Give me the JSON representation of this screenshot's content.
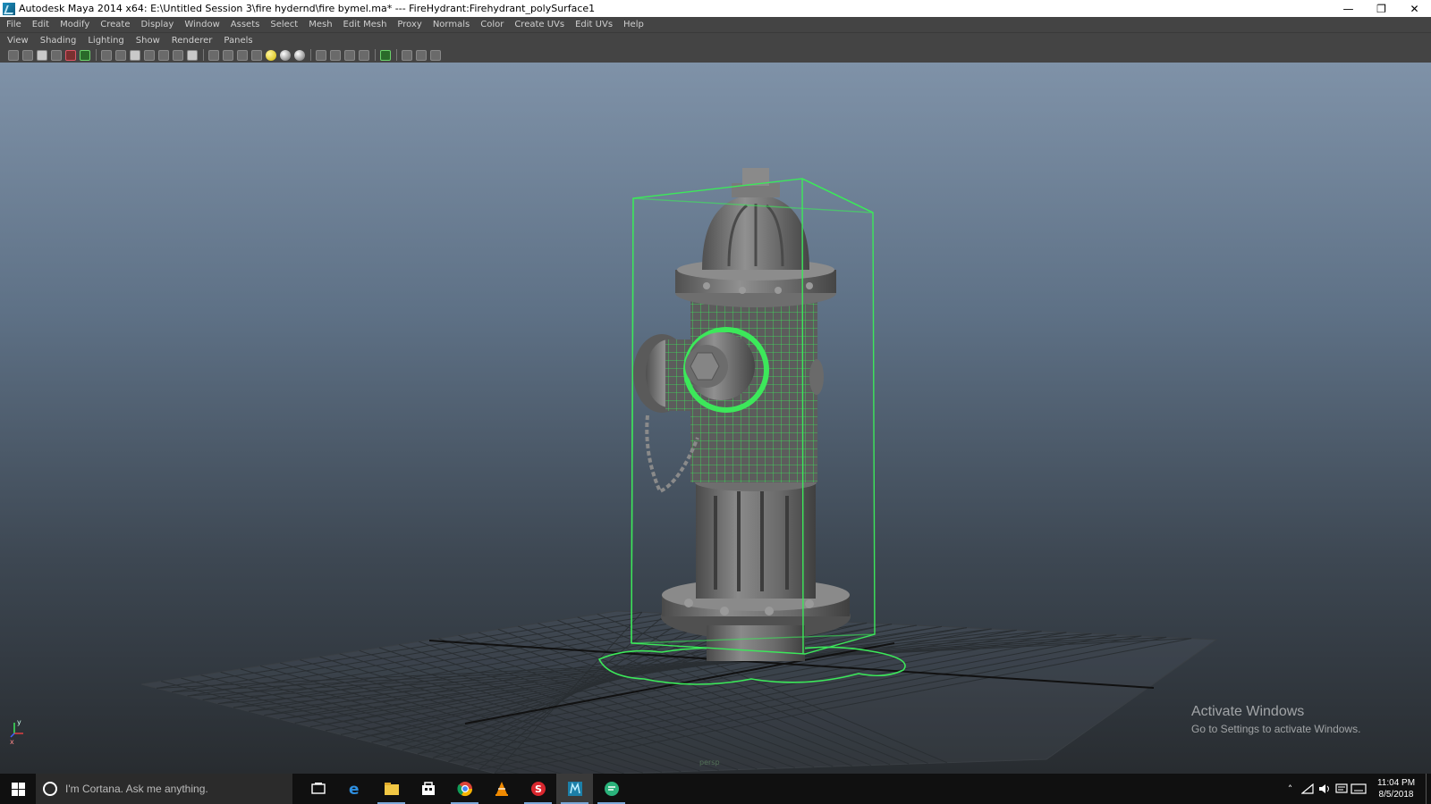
{
  "window": {
    "title": "Autodesk Maya 2014 x64: E:\\Untitled Session 3\\fire hydernd\\fire bymel.ma*   ---   FireHydrant:Firehydrant_polySurface1",
    "minimize_glyph": "—",
    "restore_glyph": "❐",
    "close_glyph": "✕"
  },
  "main_menu": [
    "File",
    "Edit",
    "Modify",
    "Create",
    "Display",
    "Window",
    "Assets",
    "Select",
    "Mesh",
    "Edit Mesh",
    "Proxy",
    "Normals",
    "Color",
    "Create UVs",
    "Edit UVs",
    "Help"
  ],
  "panel_menu": [
    "View",
    "Shading",
    "Lighting",
    "Show",
    "Renderer",
    "Panels"
  ],
  "viewport": {
    "camera_label": "persp",
    "axis_y": "y",
    "axis_x": "x",
    "selection_color": "#3ce85a",
    "mesh_color": "#6b6b6b"
  },
  "watermark": {
    "title": "Activate Windows",
    "subtitle": "Go to Settings to activate Windows."
  },
  "taskbar": {
    "cortana_placeholder": "I'm Cortana. Ask me anything.",
    "apps": [
      "task-view-icon",
      "edge-icon",
      "file-explorer-icon",
      "store-icon",
      "chrome-icon",
      "vlc-icon",
      "app-red-icon",
      "maya-icon",
      "chat-icon"
    ],
    "time": "11:04 PM",
    "date": "8/5/2018"
  }
}
